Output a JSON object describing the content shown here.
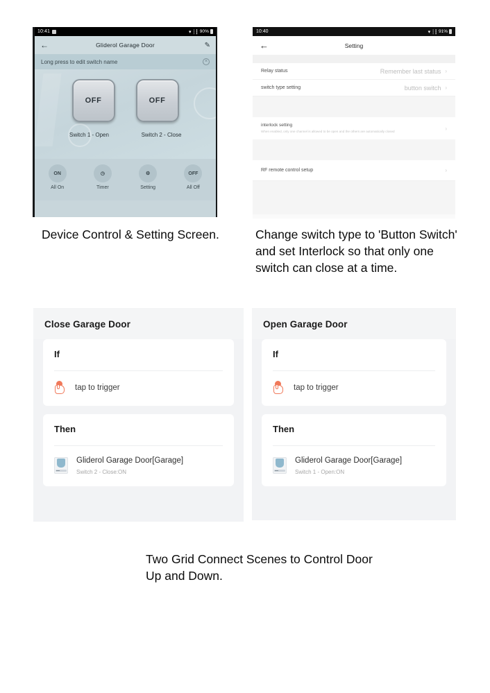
{
  "shot1": {
    "status": {
      "time": "10:41",
      "battery": "90%",
      "icons": [
        "alarm-icon",
        "wifi-icon",
        "signal-icon",
        "battery-icon"
      ]
    },
    "appbar": {
      "back": "←",
      "title": "Gliderol Garage Door",
      "edit": "✎"
    },
    "hint": {
      "text": "Long press to edit switch name",
      "close": "×"
    },
    "switches": [
      {
        "state": "OFF",
        "label": "Switch 1 - Open"
      },
      {
        "state": "OFF",
        "label": "Switch 2 - Close"
      }
    ],
    "tabs": [
      {
        "icon": "ON",
        "label": "All On"
      },
      {
        "icon": "◷",
        "label": "Timer"
      },
      {
        "icon": "⚙",
        "label": "Setting"
      },
      {
        "icon": "OFF",
        "label": "All Off"
      }
    ]
  },
  "shot2": {
    "status": {
      "time": "10:40",
      "battery": "91%"
    },
    "appbar": {
      "back": "←",
      "title": "Setting"
    },
    "rows": [
      {
        "label": "Relay status",
        "value": "Remember last status",
        "chevron": "›"
      },
      {
        "label": "switch type setting",
        "value": "button switch",
        "chevron": "›"
      }
    ],
    "interlock": {
      "title": "interlock setting",
      "desc": "When enabled, only one channel is allowed to be open and the others are automatically closed",
      "chevron": "›"
    },
    "rf": {
      "label": "RF remote control setup",
      "chevron": "›"
    }
  },
  "captions": {
    "c1": "Device Control & Setting Screen.",
    "c2": "Change switch type to 'Button Switch' and set Interlock so that only one switch can close at a time.",
    "c3": "Two Grid Connect Scenes to Control Door Up and Down."
  },
  "scenes": [
    {
      "title": "Close Garage Door",
      "if_label": "If",
      "trigger": {
        "icon": "tap-icon",
        "text": "tap to trigger"
      },
      "then_label": "Then",
      "action": {
        "icon": "device-icon",
        "name": "Gliderol Garage Door[Garage]",
        "detail": "Switch 2 - Close:ON"
      }
    },
    {
      "title": "Open Garage Door",
      "if_label": "If",
      "trigger": {
        "icon": "tap-icon",
        "text": "tap to trigger"
      },
      "then_label": "Then",
      "action": {
        "icon": "device-icon",
        "name": "Gliderol Garage Door[Garage]",
        "detail": "Switch 1 - Open:ON"
      }
    }
  ],
  "colors": {
    "accent": "#f0795a",
    "phone1_bg": "#c8d6db",
    "card_bg": "#f2f3f5",
    "text": "#1a1a1a"
  }
}
